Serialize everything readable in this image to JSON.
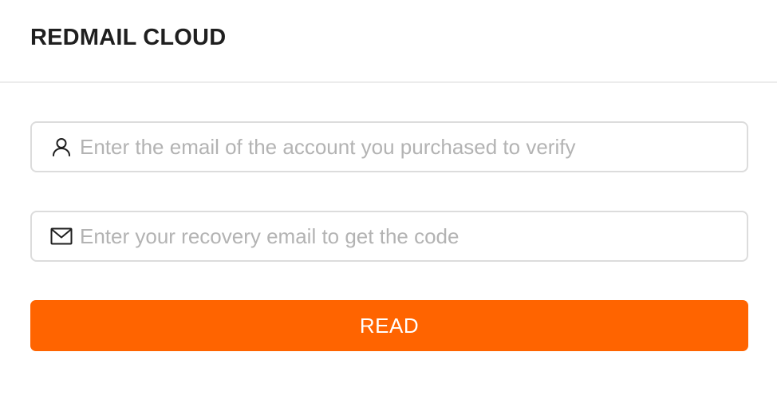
{
  "header": {
    "title": "REDMAIL CLOUD"
  },
  "form": {
    "account_email": {
      "icon": "user-icon",
      "value": "",
      "placeholder": "Enter the email of the account you purchased to verify"
    },
    "recovery_email": {
      "icon": "mail-icon",
      "value": "",
      "placeholder": "Enter your recovery email to get the code"
    },
    "submit_label": "READ"
  },
  "colors": {
    "accent": "#ff6400",
    "border": "#dcdcdc",
    "placeholder": "#b3b3b3",
    "title": "#1f1f1f"
  }
}
